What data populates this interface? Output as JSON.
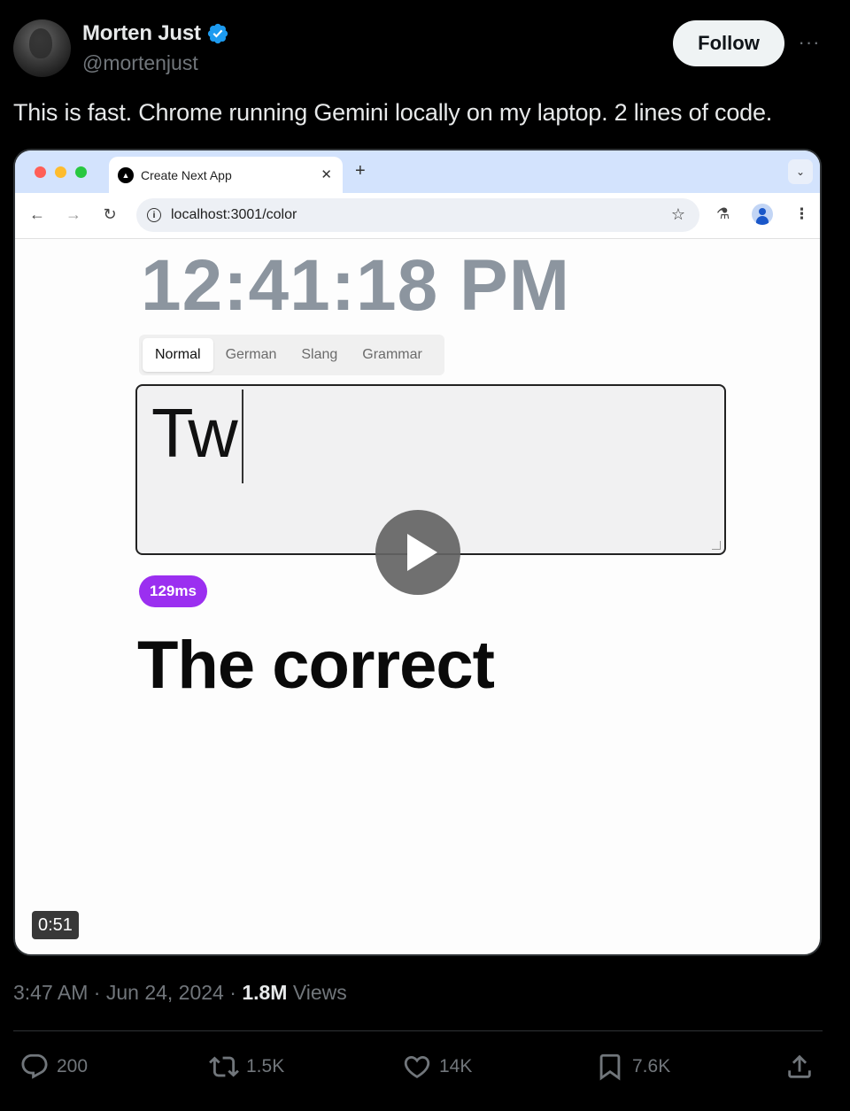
{
  "author": {
    "display_name": "Morten Just",
    "handle": "@mortenjust"
  },
  "header": {
    "follow_label": "Follow",
    "more_label": "···"
  },
  "tweet": {
    "text": "This is fast. Chrome running Gemini locally on my laptop. 2 lines of code."
  },
  "media": {
    "browser": {
      "tab_title": "Create Next App",
      "url": "localhost:3001/color"
    },
    "app": {
      "clock": "12:41:18 PM",
      "tabs": [
        "Normal",
        "German",
        "Slang",
        "Grammar"
      ],
      "input_value": "Tw",
      "latency": "129ms",
      "result": "The correct"
    },
    "duration": "0:51"
  },
  "meta": {
    "time": "3:47 AM",
    "date": "Jun 24, 2024",
    "views_count": "1.8M",
    "views_label": "Views"
  },
  "actions": {
    "replies": "200",
    "reposts": "1.5K",
    "likes": "14K",
    "bookmarks": "7.6K"
  },
  "colors": {
    "accent_verified": "#1d9bf0",
    "latency_badge": "#9b2ff0",
    "clock_text": "#8c959f"
  }
}
